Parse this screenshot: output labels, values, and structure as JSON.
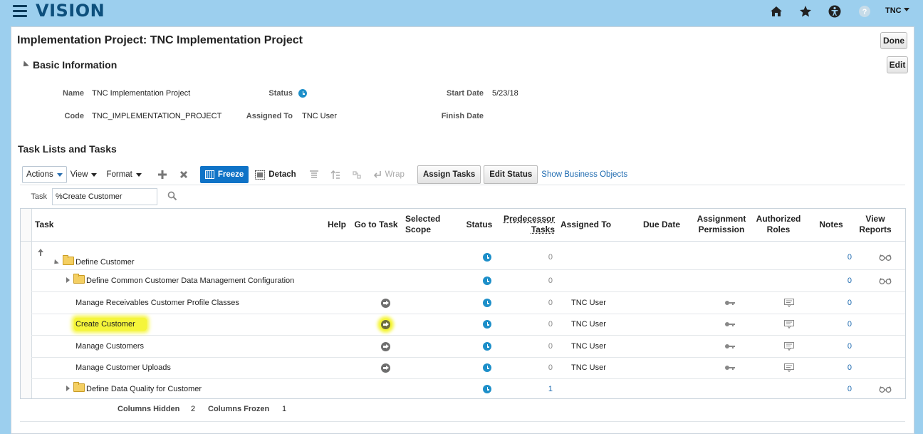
{
  "app": {
    "brand": "VISION",
    "user": "TNC"
  },
  "page": {
    "title": "Implementation Project: TNC Implementation Project",
    "done_label": "Done",
    "edit_label": "Edit"
  },
  "basic_info": {
    "title": "Basic Information",
    "name_label": "Name",
    "name_value": "TNC Implementation Project",
    "code_label": "Code",
    "code_value": "TNC_IMPLEMENTATION_PROJECT",
    "status_label": "Status",
    "assigned_label": "Assigned To",
    "assigned_value": "TNC User",
    "start_label": "Start Date",
    "start_value": "5/23/18",
    "finish_label": "Finish Date"
  },
  "tasks": {
    "title": "Task Lists and Tasks",
    "toolbar": {
      "actions": "Actions",
      "view": "View",
      "format": "Format",
      "freeze": "Freeze",
      "detach": "Detach",
      "wrap": "Wrap",
      "assign_tasks": "Assign Tasks",
      "edit_status": "Edit Status",
      "show_business_objects": "Show Business Objects"
    },
    "search": {
      "label": "Task",
      "value": "%Create Customer"
    },
    "columns": {
      "task": "Task",
      "help": "Help",
      "go_to_task": "Go to Task",
      "selected_scope": "Selected Scope",
      "status": "Status",
      "predecessor_tasks": "Predecessor Tasks",
      "assigned_to": "Assigned To",
      "due_date": "Due Date",
      "assignment_permission": "Assignment Permission",
      "authorized_roles": "Authorized Roles",
      "notes": "Notes",
      "view_reports": "View Reports"
    },
    "rows": [
      {
        "task": "Define Customer",
        "predecessor": "0",
        "assigned": "",
        "notes": "0"
      },
      {
        "task": "Define Common Customer Data Management Configuration",
        "predecessor": "0",
        "assigned": "",
        "notes": "0"
      },
      {
        "task": "Manage Receivables Customer Profile Classes",
        "predecessor": "0",
        "assigned": "TNC User",
        "notes": "0"
      },
      {
        "task": "Create Customer",
        "predecessor": "0",
        "assigned": "TNC User",
        "notes": "0"
      },
      {
        "task": "Manage Customers",
        "predecessor": "0",
        "assigned": "TNC User",
        "notes": "0"
      },
      {
        "task": "Manage Customer Uploads",
        "predecessor": "0",
        "assigned": "TNC User",
        "notes": "0"
      },
      {
        "task": "Define Data Quality for Customer",
        "predecessor": "1",
        "assigned": "",
        "notes": "0"
      }
    ],
    "footer": {
      "hidden_label": "Columns Hidden",
      "hidden_value": "2",
      "frozen_label": "Columns Frozen",
      "frozen_value": "1"
    }
  },
  "colors": {
    "accent": "#1f6bb0",
    "topbar": "#9ccfee",
    "highlight": "#f5f53a",
    "status_blue": "#1d8fc9"
  }
}
